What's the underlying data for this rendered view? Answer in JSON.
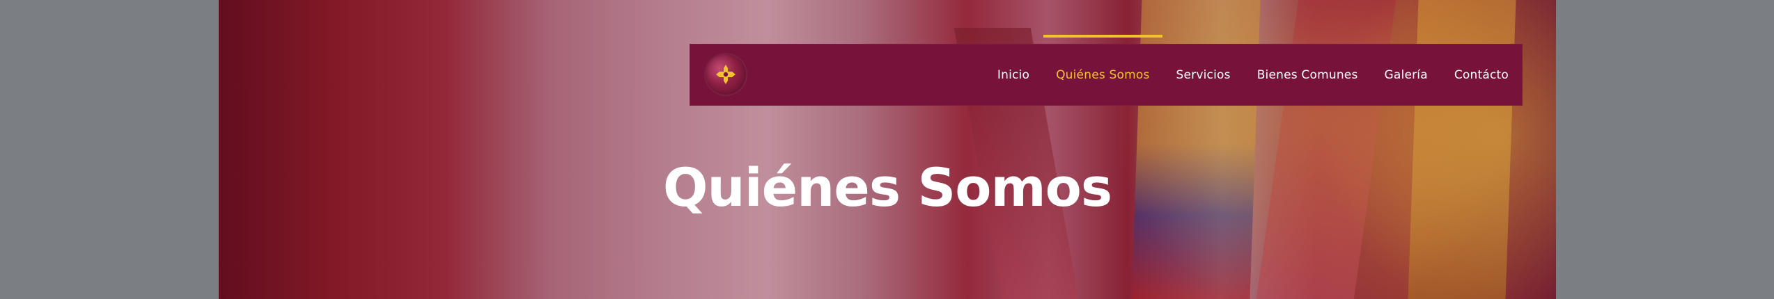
{
  "navigation": {
    "items": [
      {
        "label": "Inicio"
      },
      {
        "label": "Quiénes Somos",
        "active": true
      },
      {
        "label": "Servicios"
      },
      {
        "label": "Bienes Comunes"
      },
      {
        "label": "Galería"
      },
      {
        "label": "Contácto"
      }
    ]
  },
  "hero": {
    "title": "Quiénes Somos"
  },
  "colors": {
    "navbar_bg": "#77133a",
    "active": "#f2c331",
    "text": "#ffffff",
    "outer_bg": "#7b7f84"
  },
  "icons": {
    "logo": "cross-emblem-icon"
  }
}
